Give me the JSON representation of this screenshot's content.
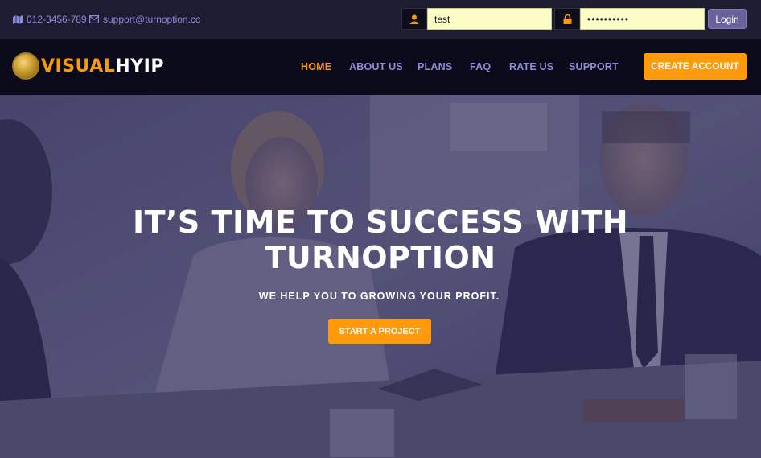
{
  "topbar": {
    "phone": "012-3456-789",
    "email": "support@turnoption.co",
    "username_value": "test",
    "password_value": "••••••••••",
    "login_label": "Login"
  },
  "brand": {
    "name_part1": "VISUAL",
    "name_part2": "HYIP"
  },
  "nav": {
    "items": [
      {
        "label": "HOME",
        "active": true
      },
      {
        "label": "ABOUT US"
      },
      {
        "label": "PLANS"
      },
      {
        "label": "FAQ"
      },
      {
        "label": "RATE US"
      },
      {
        "label": "SUPPORT"
      }
    ],
    "create_account_label": "CREATE ACCOUNT"
  },
  "hero": {
    "title_line1": "IT’S TIME TO SUCCESS WITH",
    "title_line2": "TURNOPTION",
    "subtitle": "WE HELP YOU TO GROWING YOUR PROFIT.",
    "cta_label": "START A PROJECT"
  },
  "colors": {
    "accent": "#ff9a0c",
    "nav_text": "#8f8dd6",
    "topbar_bg": "#1d1c31",
    "navbar_bg": "#0b0a1b"
  }
}
